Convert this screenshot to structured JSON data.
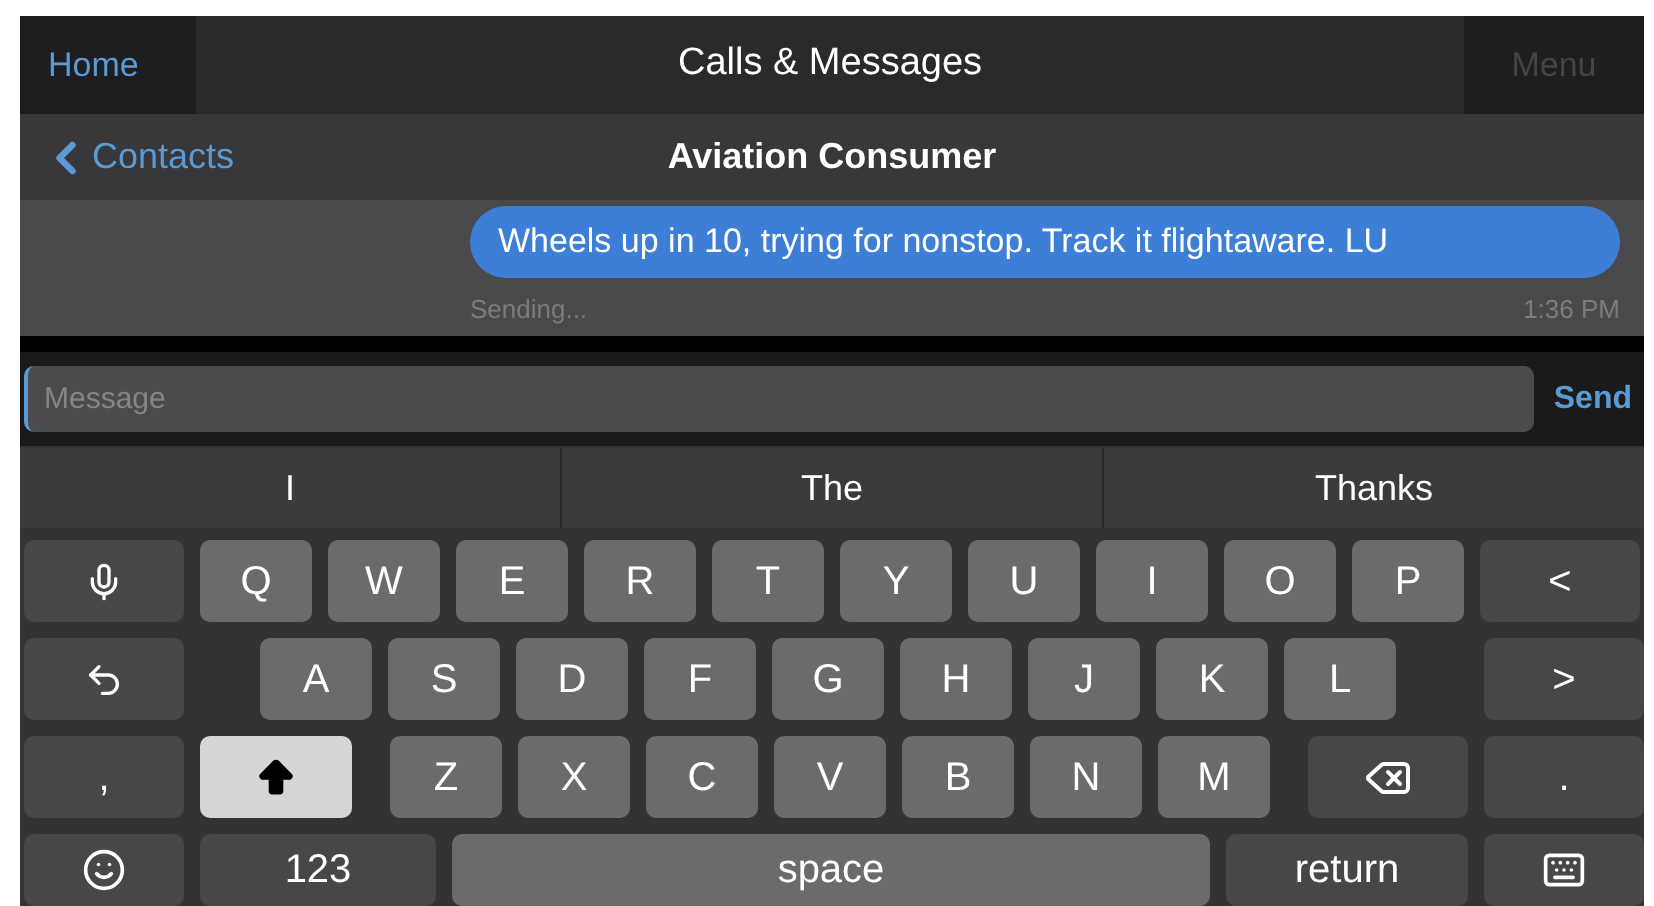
{
  "top_bar": {
    "home": "Home",
    "title": "Calls & Messages",
    "menu": "Menu"
  },
  "nav_bar": {
    "back": "Contacts",
    "title": "Aviation Consumer"
  },
  "messages": [
    {
      "text": "Wheels up in 10, trying for nonstop. Track it flightaware. LU",
      "status": "Sending...",
      "time": "1:36 PM"
    }
  ],
  "composer": {
    "placeholder": "Message",
    "send": "Send"
  },
  "suggestions": [
    "I",
    "The",
    "Thanks"
  ],
  "keyboard": {
    "rows": [
      {
        "keys": [
          {
            "kind": "mic"
          },
          {
            "kind": "letter",
            "label": "Q"
          },
          {
            "kind": "letter",
            "label": "W"
          },
          {
            "kind": "letter",
            "label": "E"
          },
          {
            "kind": "letter",
            "label": "R"
          },
          {
            "kind": "letter",
            "label": "T"
          },
          {
            "kind": "letter",
            "label": "Y"
          },
          {
            "kind": "letter",
            "label": "U"
          },
          {
            "kind": "letter",
            "label": "I"
          },
          {
            "kind": "letter",
            "label": "O"
          },
          {
            "kind": "letter",
            "label": "P"
          },
          {
            "kind": "side",
            "label": "<"
          }
        ]
      },
      {
        "keys": [
          {
            "kind": "undo"
          },
          {
            "kind": "letter",
            "label": "A"
          },
          {
            "kind": "letter",
            "label": "S"
          },
          {
            "kind": "letter",
            "label": "D"
          },
          {
            "kind": "letter",
            "label": "F"
          },
          {
            "kind": "letter",
            "label": "G"
          },
          {
            "kind": "letter",
            "label": "H"
          },
          {
            "kind": "letter",
            "label": "J"
          },
          {
            "kind": "letter",
            "label": "K"
          },
          {
            "kind": "letter",
            "label": "L"
          },
          {
            "kind": "side",
            "label": ">"
          }
        ]
      },
      {
        "keys": [
          {
            "kind": "side",
            "label": ","
          },
          {
            "kind": "shift",
            "on": true
          },
          {
            "kind": "letter",
            "label": "Z"
          },
          {
            "kind": "letter",
            "label": "X"
          },
          {
            "kind": "letter",
            "label": "C"
          },
          {
            "kind": "letter",
            "label": "V"
          },
          {
            "kind": "letter",
            "label": "B"
          },
          {
            "kind": "letter",
            "label": "N"
          },
          {
            "kind": "letter",
            "label": "M"
          },
          {
            "kind": "backspace"
          },
          {
            "kind": "side",
            "label": "."
          }
        ]
      },
      {
        "keys": [
          {
            "kind": "emoji"
          },
          {
            "kind": "numbers",
            "label": "123"
          },
          {
            "kind": "space",
            "label": "space"
          },
          {
            "kind": "return",
            "label": "return"
          },
          {
            "kind": "hide"
          }
        ]
      }
    ]
  }
}
